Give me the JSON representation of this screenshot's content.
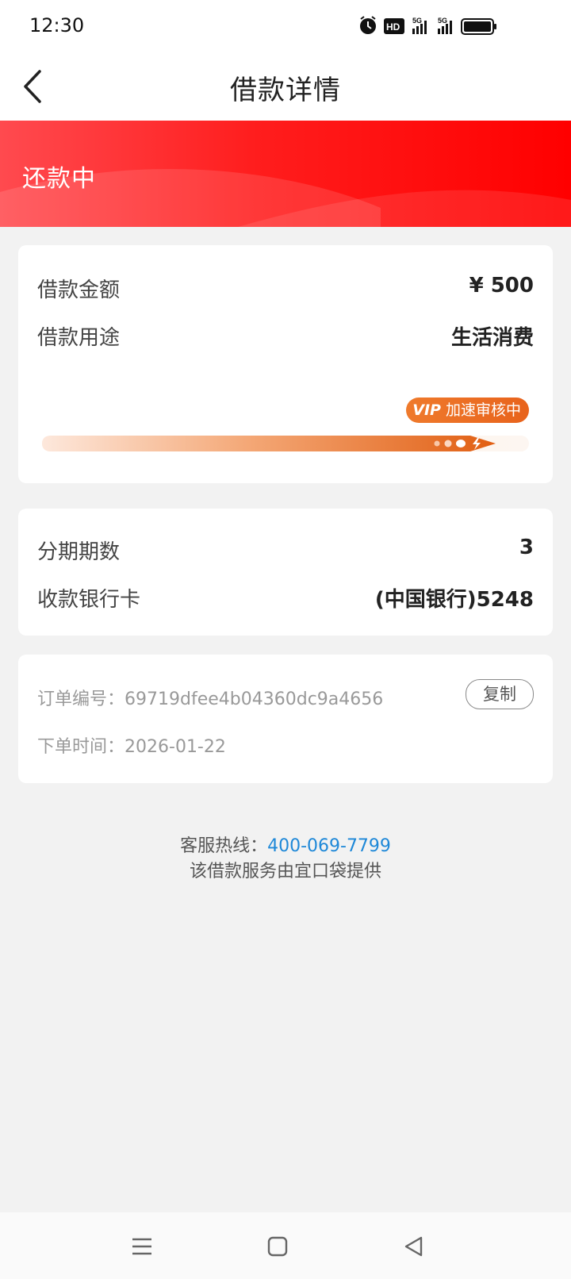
{
  "status_bar": {
    "time": "12:30"
  },
  "nav": {
    "title": "借款详情"
  },
  "banner": {
    "status": "还款中"
  },
  "loan_card": {
    "amount_label": "借款金额",
    "amount_value": "¥ 500",
    "purpose_label": "借款用途",
    "purpose_value": "生活消费",
    "vip_badge": "VIP",
    "vip_text": "加速审核中"
  },
  "installment_card": {
    "period_label": "分期期数",
    "period_value": "3",
    "bank_label": "收款银行卡",
    "bank_value": "(中国银行)5248"
  },
  "order_card": {
    "order_no_label": "订单编号：",
    "order_no": "69719dfee4b04360dc9a4656",
    "copy_label": "复制",
    "time_label": "下单时间：",
    "time_value": "2026-01-22"
  },
  "footer": {
    "hotline_label": "客服热线：",
    "hotline_number": "400-069-7799",
    "provider": "该借款服务由宜口袋提供"
  },
  "colors": {
    "banner": "#ff1d1d",
    "accent": "#e8631c",
    "link": "#1e88d8"
  }
}
